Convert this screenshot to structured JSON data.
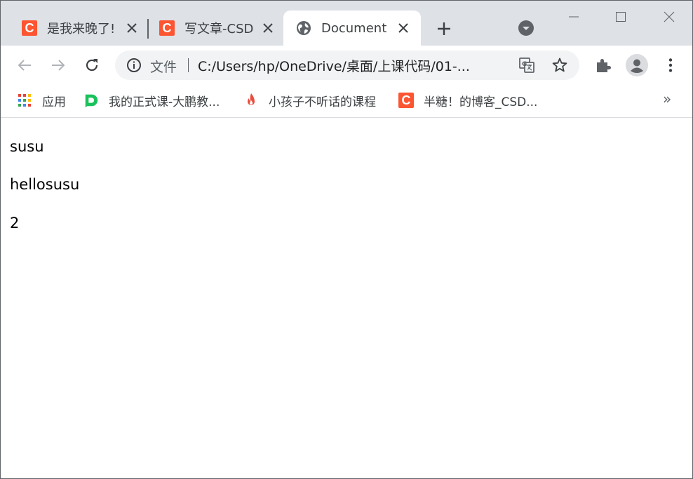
{
  "browser": {
    "tabs": [
      {
        "title": "是我来晚了!",
        "favicon": "csdn-c-icon",
        "active": false
      },
      {
        "title": "写文章-CSDN",
        "favicon": "csdn-c-icon",
        "active": false
      },
      {
        "title": "Document",
        "favicon": "globe-icon",
        "active": true
      }
    ],
    "address_bar": {
      "scheme_label": "文件",
      "url": "C:/Users/hp/OneDrive/桌面/上课代码/01-..."
    },
    "bookmarks": [
      {
        "label": "应用",
        "icon": "apps-grid-icon"
      },
      {
        "label": "我的正式课-大鹏教...",
        "icon": "dapeng-icon"
      },
      {
        "label": "小孩子不听话的课程",
        "icon": "flame-icon"
      },
      {
        "label": "半糖！的博客_CSD...",
        "icon": "csdn-c-icon"
      }
    ],
    "bookmarks_overflow": "»",
    "colors": {
      "tabstrip": "#dee1e6",
      "csdn": "#fc5531",
      "dapeng": "#19c25a",
      "flame": "#e84d3d"
    }
  },
  "page": {
    "lines": [
      "susu",
      "hellosusu",
      "2"
    ]
  }
}
